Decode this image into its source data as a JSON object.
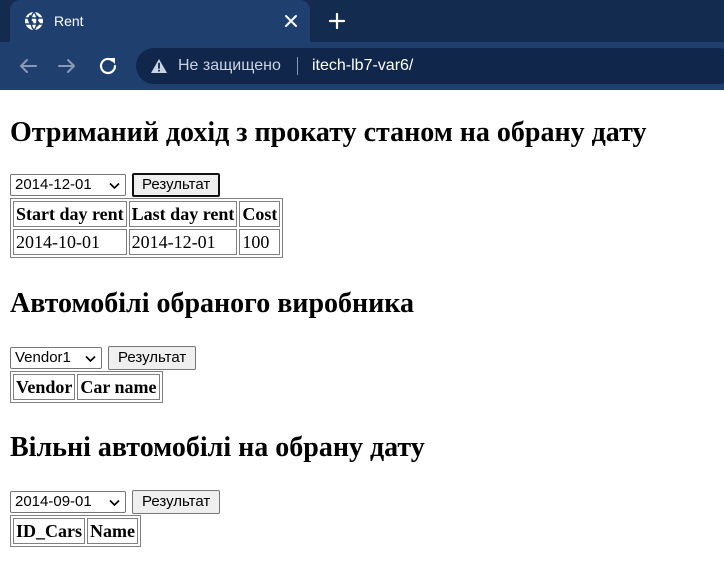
{
  "browser": {
    "tab_title": "Rent",
    "security_label": "Не защищено",
    "url": "itech-lb7-var6/"
  },
  "income": {
    "title": "Отриманий дохід з прокату станом на обрану дату",
    "select_value": "2014-12-01",
    "button_label": "Результат",
    "headers": [
      "Start day rent",
      "Last day rent",
      "Cost"
    ],
    "rows": [
      [
        "2014-10-01",
        "2014-12-01",
        "100"
      ]
    ]
  },
  "vendor": {
    "title": "Автомобілі обраного виробника",
    "select_value": "Vendor1",
    "button_label": "Результат",
    "headers": [
      "Vendor",
      "Car name"
    ]
  },
  "free_cars": {
    "title": "Вільні автомобілі на обрану дату",
    "select_value": "2014-09-01",
    "button_label": "Результат",
    "headers": [
      "ID_Cars",
      "Name"
    ]
  }
}
